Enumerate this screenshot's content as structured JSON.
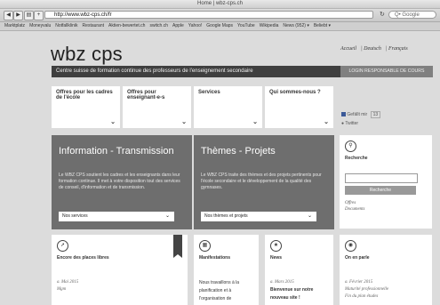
{
  "browser": {
    "window_title": "Home | wbz-cps.ch",
    "url": "http://www.wbz-cps.ch/fr",
    "search_placeholder": "Q• Google",
    "bookmarks": [
      "Marktplatz",
      "Moneyvalu",
      "Notfallklinik",
      "Restaurant",
      "Aktien-bewertet.ch",
      "switch.ch",
      "Apple",
      "Yahoo!",
      "Google Maps",
      "YouTube",
      "Wikipedia",
      "News (952) ▾",
      "Beliebt ▾"
    ]
  },
  "site": {
    "logo": "wbz cps",
    "languages": [
      "Accueil",
      "Deutsch",
      "Français"
    ],
    "banner": "Centre suisse de formation continue des professeurs de l'enseignement secondaire",
    "login": "LOGIN RESPONSABLE DE COURS"
  },
  "menu_cards": [
    {
      "label": "Offres pour les cadres de l'école"
    },
    {
      "label": "Offres pour enseignant-e-s"
    },
    {
      "label": "Services"
    },
    {
      "label": "Qui sommes-nous ?"
    }
  ],
  "social": {
    "facebook": "Gefällt mir",
    "fb_count": "13",
    "twitter": "Twitter"
  },
  "info_box": {
    "title": "Information - Transmission",
    "text": "Le WBZ CPS soutient les cadres et les enseignants dans leur formation continue. Il met à votre disposition tout des services de conseil, d'information et de transmission.",
    "select": "Nos services"
  },
  "themes_box": {
    "title": "Thèmes - Projets",
    "text": "Le WBZ CPS traite des thèmes et des projets pertinents pour l'école secondaire et le développement de la qualité des gymnases.",
    "select": "Nos thèmes et projets"
  },
  "search": {
    "label": "Recherche",
    "button": "Recherche",
    "links": [
      "Offres",
      "Documents"
    ]
  },
  "bottom_cards": [
    {
      "title": "Encore des places libres",
      "sub1": "a. Mai 2015",
      "sub2": "Mgm"
    },
    {
      "title": "Manifestations",
      "sub1": "Nous travaillons à la",
      "sub2": "planification et à",
      "sub3": "l'organisation de"
    },
    {
      "title": "News",
      "sub1": "a. Mars 2015",
      "sub2": "Bienvenue sur notre",
      "sub3": "nouveau site !"
    },
    {
      "title": "On en parle",
      "sub1": "a. Février 2015",
      "sub2": "Maturité professionnelle",
      "sub3": "Fin du plan études"
    }
  ]
}
